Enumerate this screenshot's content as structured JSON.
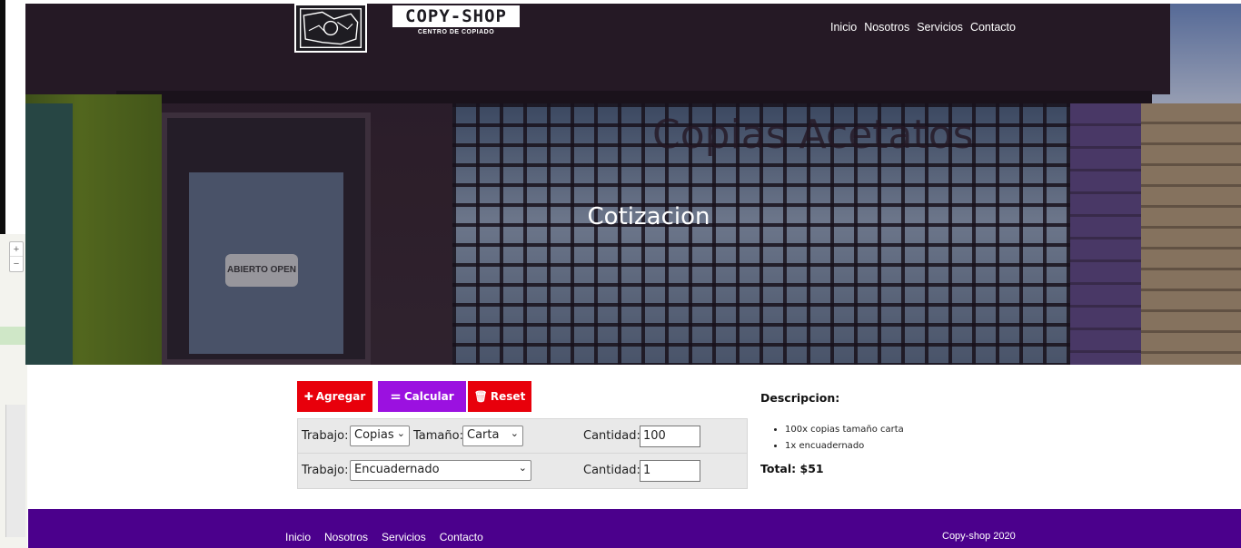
{
  "brand": {
    "title": "COPY-SHOP",
    "subtitle": "CENTRO DE COPIADO"
  },
  "nav": [
    "Inicio",
    "Nosotros",
    "Servicios",
    "Contacto"
  ],
  "hero": {
    "title": "Cotizacion",
    "painted_text": "Copias Acetatos",
    "door_sign": "ABIERTO OPEN"
  },
  "map": {
    "zoom_in": "+",
    "zoom_out": "−"
  },
  "buttons": {
    "add": "Agregar",
    "calc": "Calcular",
    "reset": "Reset"
  },
  "rows": [
    {
      "trabajo_label": "Trabajo:",
      "trabajo_value": "Copias",
      "tamano_label": "Tamaño:",
      "tamano_value": "Carta",
      "cantidad_label": "Cantidad:",
      "cantidad_value": "100"
    },
    {
      "trabajo_label": "Trabajo:",
      "trabajo_value": "Encuadernado",
      "cantidad_label": "Cantidad:",
      "cantidad_value": "1"
    }
  ],
  "descripcion": {
    "heading": "Descripcion:",
    "items": [
      "100x copias tamaño carta",
      "1x encuadernado"
    ],
    "total": "Total: $51"
  },
  "footer": {
    "nav": [
      "Inicio",
      "Nosotros",
      "Servicios",
      "Contacto"
    ],
    "copyright": "Copy-shop 2020"
  },
  "colors": {
    "red": "#e8000b",
    "purple_button": "#9b11e0",
    "footer": "#4b008c"
  }
}
